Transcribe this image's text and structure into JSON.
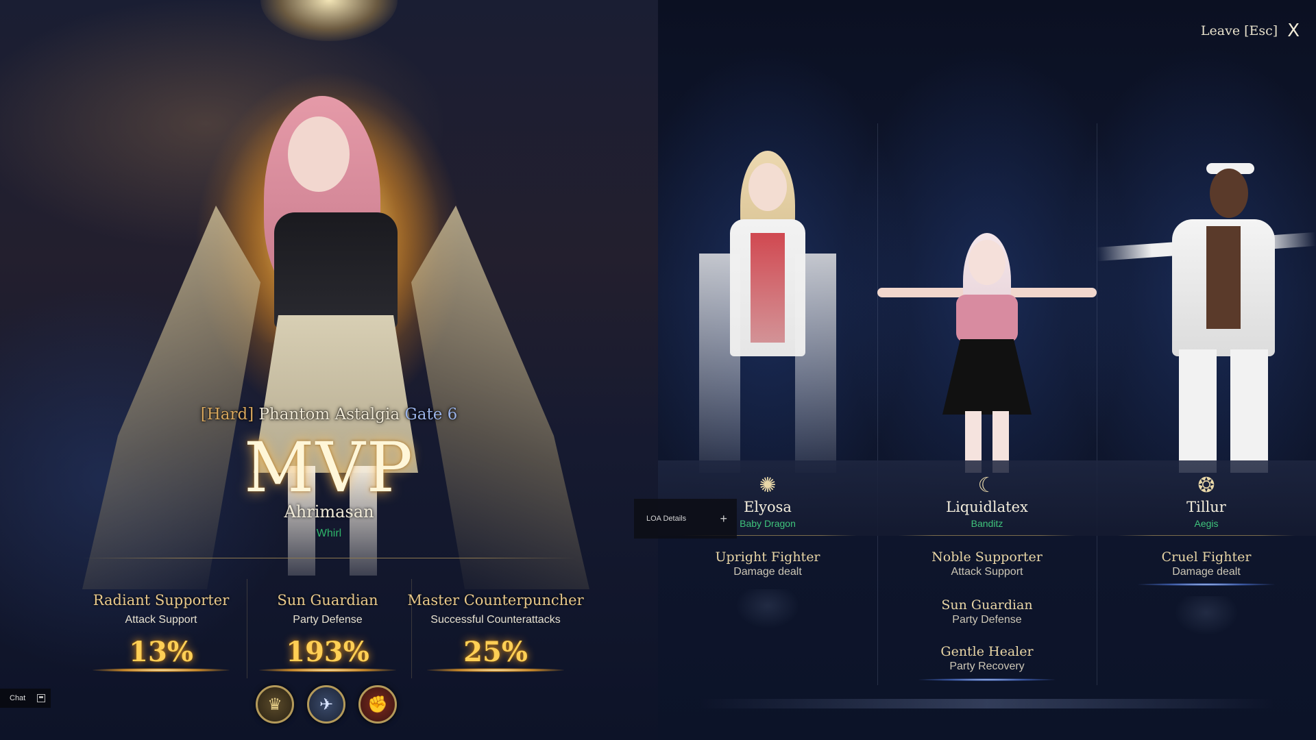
{
  "raid": {
    "difficulty": "[Hard]",
    "name": "Phantom Astalgia",
    "gate": "Gate 6"
  },
  "mvp": {
    "label": "MVP",
    "player_name": "Ahrimasan",
    "guild": "Whirl",
    "awards": [
      {
        "title": "Radiant Supporter",
        "subtitle": "Attack Support",
        "value": "13%"
      },
      {
        "title": "Sun Guardian",
        "subtitle": "Party Defense",
        "value": "193%"
      },
      {
        "title": "Master Counterpuncher",
        "subtitle": "Successful Counterattacks",
        "value": "25%"
      }
    ],
    "badges": [
      "crown-badge-icon",
      "bird-badge-icon",
      "fist-badge-icon"
    ]
  },
  "party": [
    {
      "name": "Elyosa",
      "guild": "Baby Dragon",
      "class_icon": "sun-crest-icon",
      "awards": [
        {
          "title": "Upright Fighter",
          "subtitle": "Damage dealt"
        }
      ]
    },
    {
      "name": "Liquidlatex",
      "guild": "Banditz",
      "class_icon": "moon-crest-icon",
      "awards": [
        {
          "title": "Noble Supporter",
          "subtitle": "Attack Support"
        },
        {
          "title": "Sun Guardian",
          "subtitle": "Party Defense"
        },
        {
          "title": "Gentle Healer",
          "subtitle": "Party Recovery"
        }
      ]
    },
    {
      "name": "Tillur",
      "guild": "Aegis",
      "class_icon": "winged-crest-icon",
      "awards": [
        {
          "title": "Cruel Fighter",
          "subtitle": "Damage dealt"
        }
      ]
    }
  ],
  "ui": {
    "leave_label": "Leave [Esc]",
    "close_glyph": "X",
    "loa_details_label": "LOA Details",
    "loa_details_plus": "+",
    "chat_label": "Chat"
  },
  "colors": {
    "gold_accent": "#ffcf55",
    "award_title": "#e9c98a",
    "guild_green": "#2fb56a",
    "gate_blue": "#9ab3e8",
    "background": "#0a0f22"
  }
}
